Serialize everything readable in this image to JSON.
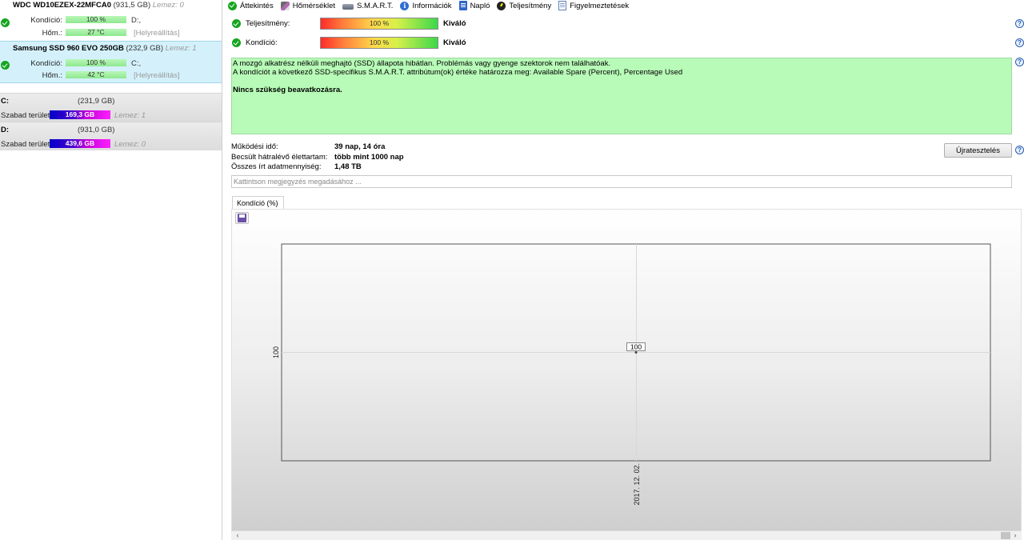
{
  "drives": [
    {
      "name": "WDC WD10EZEX-22MFCA0",
      "size": "(931,5 GB)",
      "disk": "Lemez: 0",
      "health_label": "Kondíció:",
      "health_value": "100 %",
      "health_tail": "D:,",
      "temp_label": "Hőm.:",
      "temp_value": "27 °C",
      "temp_tail": "[Helyreállítás]",
      "selected": false
    },
    {
      "name": "Samsung SSD 960 EVO 250GB",
      "size": "(232,9 GB)",
      "disk": "Lemez: 1",
      "health_label": "Kondíció:",
      "health_value": "100 %",
      "health_tail": "C:,",
      "temp_label": "Hőm.:",
      "temp_value": "42 °C",
      "temp_tail": "[Helyreállítás]",
      "selected": true
    }
  ],
  "partitions": [
    {
      "name": "C:",
      "size": "(231,9 GB)",
      "free_label": "Szabad terület",
      "free_value": "169,3 GB",
      "disk": "Lemez: 1"
    },
    {
      "name": "D:",
      "size": "(931,0 GB)",
      "free_label": "Szabad terület",
      "free_value": "439,6 GB",
      "disk": "Lemez: 0"
    }
  ],
  "tabs": [
    {
      "label": "Áttekintés",
      "icon": "check-icon",
      "active": true
    },
    {
      "label": "Hőmérséklet",
      "icon": "pen-icon",
      "active": false
    },
    {
      "label": "S.M.A.R.T.",
      "icon": "disk-icon",
      "active": false
    },
    {
      "label": "Információk",
      "icon": "info-icon",
      "active": false
    },
    {
      "label": "Napló",
      "icon": "document-icon",
      "active": false
    },
    {
      "label": "Teljesítmény",
      "icon": "gauge-icon",
      "active": false
    },
    {
      "label": "Figyelmeztetések",
      "icon": "page-icon",
      "active": false
    }
  ],
  "status": {
    "performance": {
      "label": "Teljesítmény:",
      "bar_text": "100 %",
      "level_percent": 100,
      "value": "Kiváló"
    },
    "health": {
      "label": "Kondíció:",
      "bar_text": "100 %",
      "level_percent": 100,
      "value": "Kiváló"
    }
  },
  "description": {
    "line1": "A mozgó alkatrész nélküli meghajtó (SSD) állapota hibátlan. Problémás vagy gyenge szektorok nem találhatóak.",
    "line2": "A kondíciót a következő SSD-specifikus S.M.A.R.T. attribútum(ok) értéke határozza meg:  Available Spare (Percent), Percentage Used",
    "action": "Nincs szükség beavatkozásra."
  },
  "stats": {
    "uptime_label": "Működési idő:",
    "uptime_value": "39 nap, 14 óra",
    "lifetime_label": "Becsült hátralévő élettartam:",
    "lifetime_value": "több mint 1000 nap",
    "written_label": "Összes írt adatmennyiség:",
    "written_value": "1,48 TB"
  },
  "retest_label": "Újratesztelés",
  "note_placeholder": "Kattintson megjegyzés megadásához ...",
  "chart_tab_label": "Kondíció  (%)",
  "help_glyph": "?",
  "colors": {
    "ok_green": "#15a51e",
    "description_bg": "#b8fbb8",
    "selected_drive_bg": "#d4f1fb",
    "free_bar": "#c000d8"
  },
  "chart_data": {
    "type": "line",
    "series": [
      {
        "x": [
          "2017. 12. 02."
        ],
        "values": [
          100
        ]
      }
    ],
    "x_tick_labels": [
      "2017. 12. 02."
    ],
    "y_tick_labels": [
      "100"
    ],
    "data_labels": [
      "100"
    ],
    "xlabel": "",
    "ylabel": "",
    "grid": true
  }
}
